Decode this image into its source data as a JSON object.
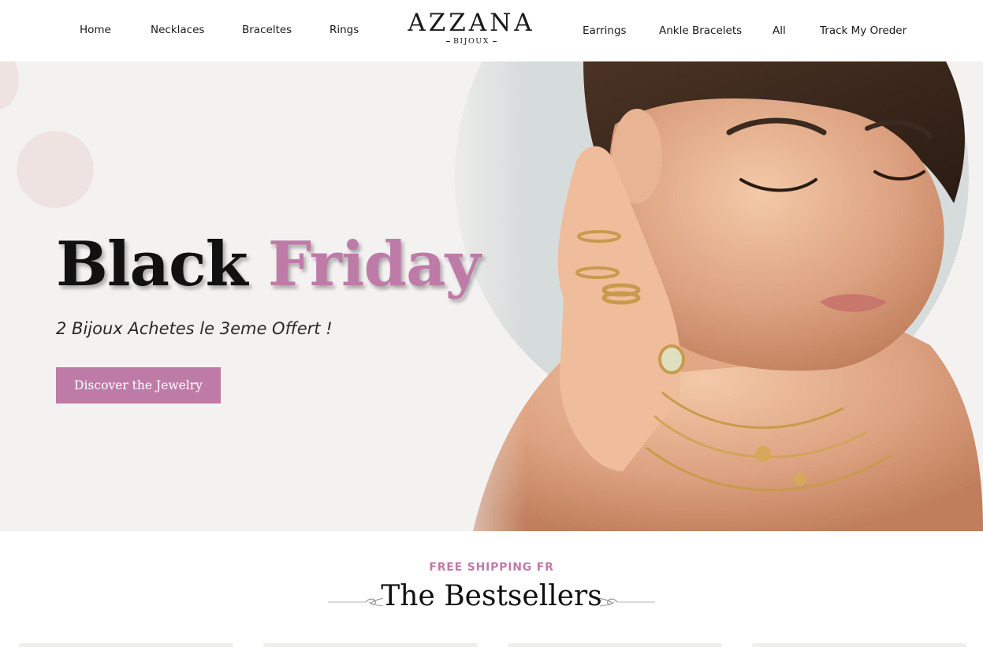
{
  "header": {
    "nav_left": [
      "Home",
      "Necklaces",
      "Braceltes",
      "Rings"
    ],
    "logo": {
      "main": "AZZANA",
      "sub": "BIJOUX"
    },
    "nav_right": [
      "Earrings",
      "Ankle Bracelets",
      "All",
      "Track My Oreder"
    ]
  },
  "hero": {
    "title_word1": "Black",
    "title_word2": "Friday",
    "subtitle": "2 Bijoux Achetes le 3eme Offert !",
    "cta_label": "Discover the Jewelry"
  },
  "bestsellers": {
    "eyebrow": "FREE SHIPPING FR",
    "title": "The Bestsellers"
  },
  "colors": {
    "accent": "#bf7ba8",
    "hero_bg": "#f4f2f1",
    "circle": "#d6dcdb",
    "deco_circle": "#efe3e2",
    "text": "#111111"
  }
}
